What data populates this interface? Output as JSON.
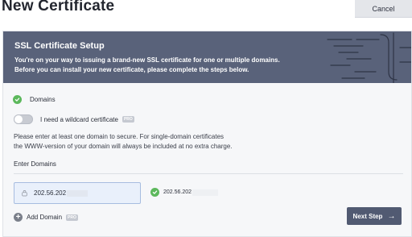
{
  "header": {
    "title": "New Certificate",
    "cancel_label": "Cancel"
  },
  "banner": {
    "title": "SSL Certificate Setup",
    "line1": "You're on your way to issuing a brand-new SSL certificate for one or multiple domains.",
    "line2": "Before you can install your new certificate, please complete the steps below.",
    "background_color": "#59627a"
  },
  "step": {
    "label": "Domains",
    "status_icon": "check-circle-icon",
    "status_color": "#5cb85c"
  },
  "wildcard": {
    "label": "I need a wildcard certificate",
    "badge": "PRO",
    "enabled": false
  },
  "help": {
    "line1": "Please enter at least one domain to secure. For single-domain certificates",
    "line2": "the WWW-version of your domain will always be included at no extra charge."
  },
  "domains": {
    "section_label": "Enter Domains",
    "input_value": "202.56.202",
    "validated_domain": "202.56.202"
  },
  "actions": {
    "add_domain_label": "Add Domain",
    "add_domain_badge": "PRO",
    "next_label": "Next Step",
    "next_color": "#515a72"
  }
}
